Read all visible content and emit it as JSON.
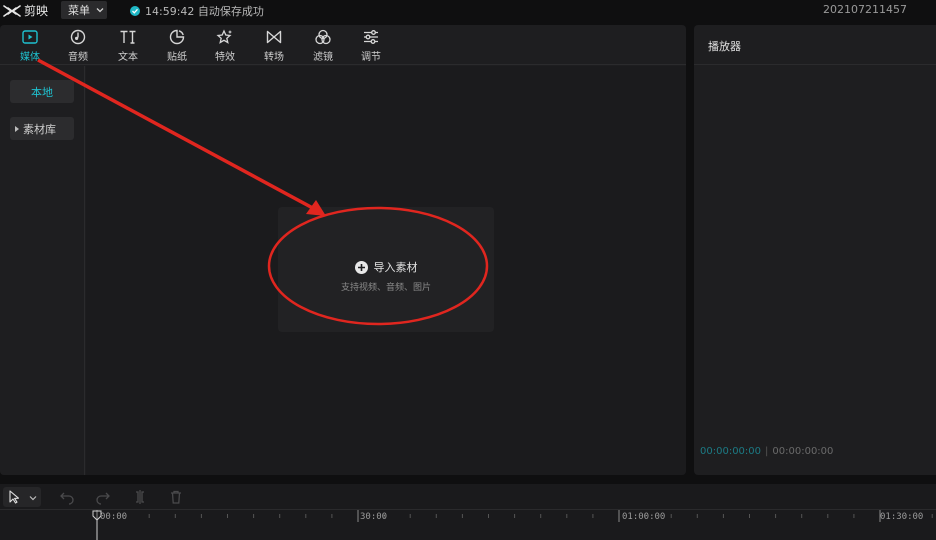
{
  "app": {
    "title": "剪映",
    "menu_label": "菜单",
    "autosave_text": "14:59:42 自动保存成功",
    "project_id": "202107211457"
  },
  "colors": {
    "accent": "#1fc1cf",
    "annotation": "#e0261f",
    "panel": "#1e1e20",
    "background": "#0f0f10"
  },
  "toolbar": {
    "tools": [
      {
        "label": "媒体",
        "icon": "media-icon",
        "active": true
      },
      {
        "label": "音频",
        "icon": "audio-icon",
        "active": false
      },
      {
        "label": "文本",
        "icon": "text-icon",
        "active": false
      },
      {
        "label": "贴纸",
        "icon": "sticker-icon",
        "active": false
      },
      {
        "label": "特效",
        "icon": "effects-icon",
        "active": false
      },
      {
        "label": "转场",
        "icon": "transition-icon",
        "active": false
      },
      {
        "label": "滤镜",
        "icon": "filter-icon",
        "active": false
      },
      {
        "label": "调节",
        "icon": "adjust-icon",
        "active": false
      }
    ]
  },
  "sidebar": {
    "local_label": "本地",
    "library_label": "素材库"
  },
  "import": {
    "label": "导入素材",
    "hint": "支持视频、音频、图片"
  },
  "player": {
    "title": "播放器",
    "current_time": "00:00:00:00",
    "total_time": "00:00:00:00"
  },
  "timeline": {
    "ticks": [
      "00:00",
      "30:00",
      "01:00:00",
      "01:30:00"
    ]
  }
}
